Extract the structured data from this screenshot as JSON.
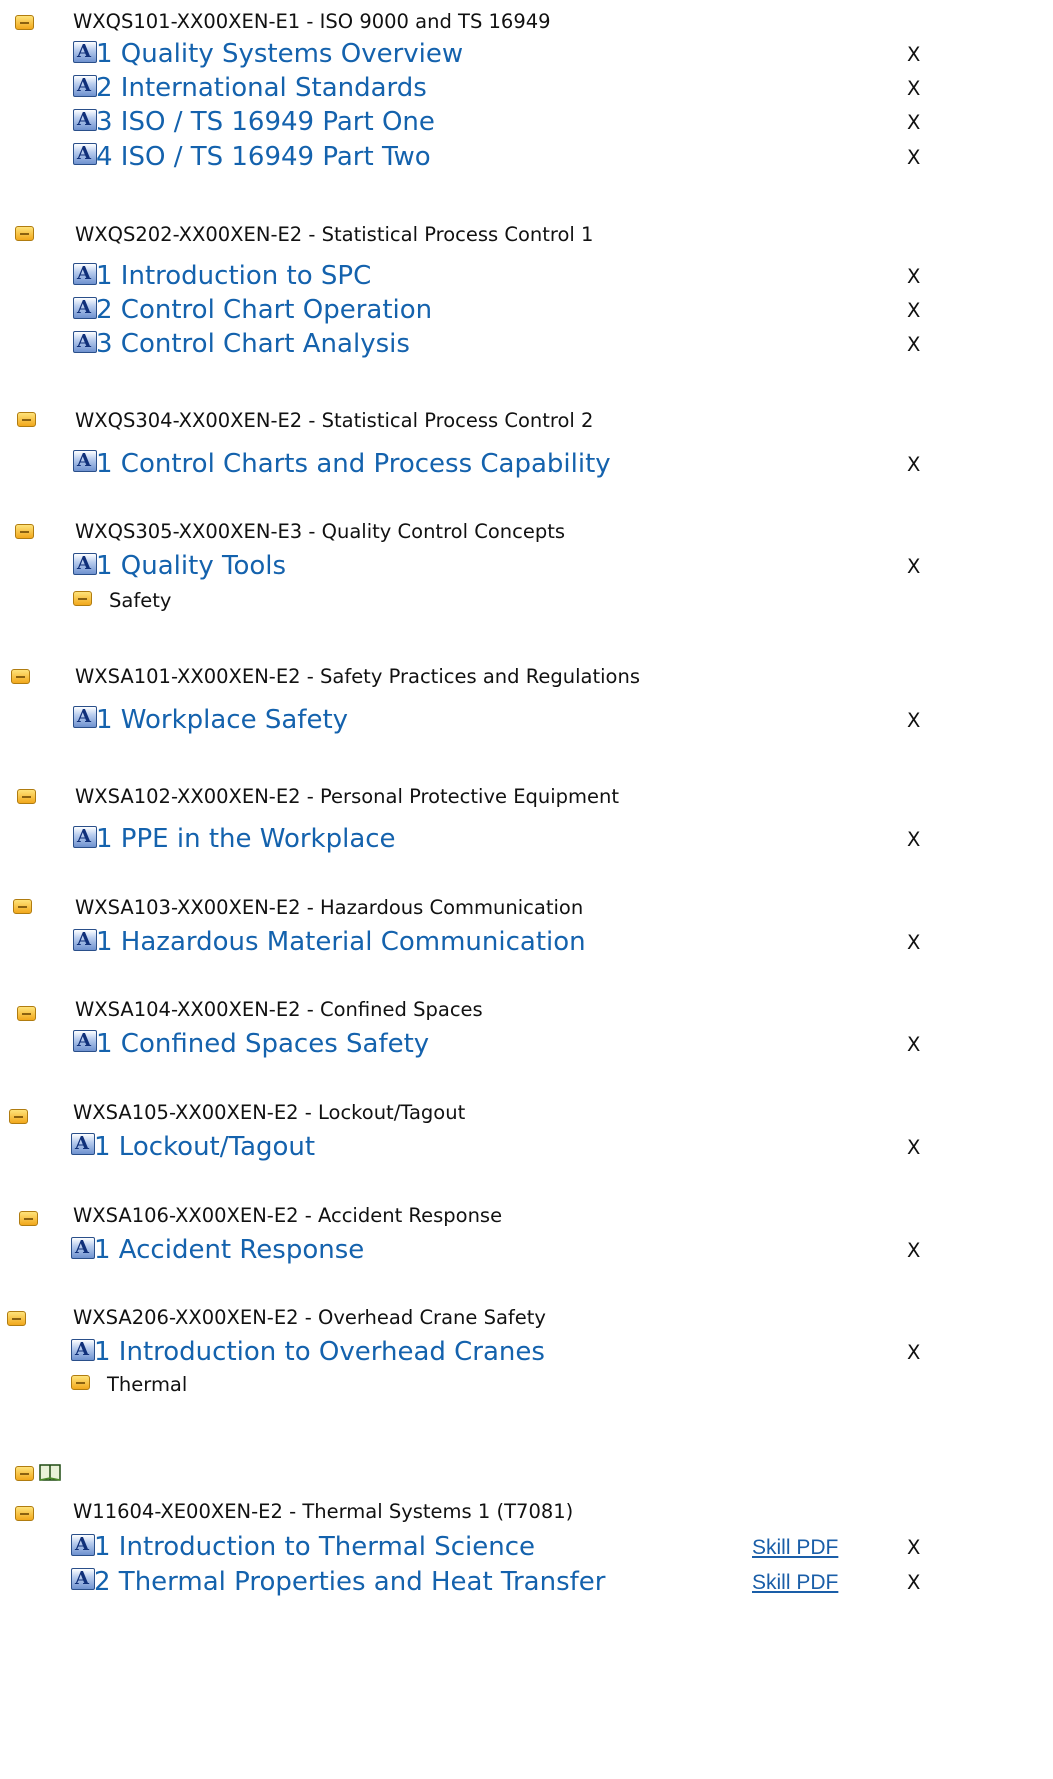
{
  "toggle_icon": "collapse-minus-icon",
  "lesson_icon_glyph": "A",
  "x_label": "X",
  "pdf_label": "Skill PDF",
  "courses": [
    {
      "title": "WXQS101-XX00XEN-E1 - ISO 9000 and TS 16949",
      "lessons": [
        {
          "label": "1 Quality Systems Overview"
        },
        {
          "label": "2 International Standards"
        },
        {
          "label": "3 ISO / TS 16949 Part One"
        },
        {
          "label": "4 ISO / TS 16949 Part Two"
        }
      ]
    },
    {
      "title": "WXQS202-XX00XEN-E2 - Statistical Process Control 1",
      "lessons": [
        {
          "label": "1 Introduction to SPC"
        },
        {
          "label": "2 Control Chart Operation"
        },
        {
          "label": "3 Control Chart Analysis"
        }
      ]
    },
    {
      "title": "WXQS304-XX00XEN-E2 - Statistical Process Control 2",
      "lessons": [
        {
          "label": "1 Control Charts and Process Capability"
        }
      ]
    },
    {
      "title": "WXQS305-XX00XEN-E3 - Quality Control Concepts",
      "lessons": [
        {
          "label": "1 Quality Tools"
        }
      ]
    },
    {
      "title": "WXSA101-XX00XEN-E2 - Safety Practices and Regulations",
      "lessons": [
        {
          "label": "1 Workplace Safety"
        }
      ]
    },
    {
      "title": "WXSA102-XX00XEN-E2 - Personal Protective Equipment",
      "lessons": [
        {
          "label": "1 PPE in the Workplace"
        }
      ]
    },
    {
      "title": "WXSA103-XX00XEN-E2 - Hazardous Communication",
      "lessons": [
        {
          "label": "1 Hazardous Material Communication"
        }
      ]
    },
    {
      "title": "WXSA104-XX00XEN-E2 - Confined Spaces",
      "lessons": [
        {
          "label": "1 Confined Spaces Safety"
        }
      ]
    },
    {
      "title": "WXSA105-XX00XEN-E2 - Lockout/Tagout",
      "lessons": [
        {
          "label": "1 Lockout/Tagout"
        }
      ]
    },
    {
      "title": "WXSA106-XX00XEN-E2 - Accident Response",
      "lessons": [
        {
          "label": "1 Accident Response"
        }
      ]
    },
    {
      "title": "WXSA206-XX00XEN-E2 - Overhead Crane Safety",
      "lessons": [
        {
          "label": "1 Introduction to Overhead Cranes"
        }
      ]
    },
    {
      "title": "W11604-XE00XEN-E2 - Thermal Systems 1 (T7081)",
      "lessons": [
        {
          "label": "1 Introduction to Thermal Science",
          "pdf": true
        },
        {
          "label": "2 Thermal Properties and Heat Transfer",
          "pdf": true
        }
      ]
    }
  ],
  "categories": {
    "safety": "Safety",
    "thermal": "Thermal"
  },
  "book_icon": "open-book-icon"
}
